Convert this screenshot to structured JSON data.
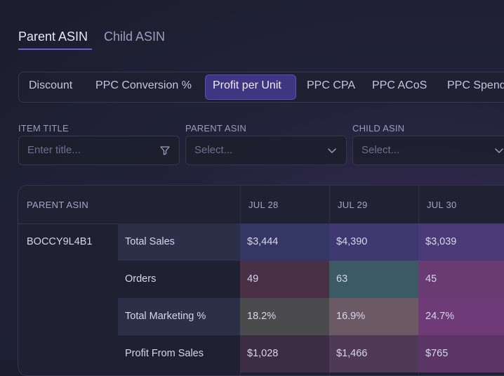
{
  "top_tabs": {
    "parent": "Parent ASIN",
    "child": "Child ASIN"
  },
  "metrics": [
    "Discount",
    "PPC Conversion %",
    "Profit per Unit",
    "PPC CPA",
    "PPC ACoS",
    "PPC Spend"
  ],
  "active_metric": "Profit per Unit",
  "filters": {
    "item_title_label": "ITEM TITLE",
    "item_title_placeholder": "Enter title...",
    "parent_asin_label": "PARENT ASIN",
    "parent_asin_placeholder": "Select...",
    "child_asin_label": "CHILD ASIN",
    "child_asin_placeholder": "Select..."
  },
  "table": {
    "header": {
      "parent_asin": "PARENT ASIN",
      "dates": [
        "JUL 28",
        "JUL 29",
        "JUL 30"
      ]
    },
    "asin": "BOCCY9L4B1",
    "rows": [
      {
        "label": "Total Sales",
        "values": [
          "$3,444",
          "$4,390",
          "$3,039"
        ],
        "colors": [
          "#343764",
          "#3d3870",
          "#4a3b78"
        ]
      },
      {
        "label": "Orders",
        "values": [
          "49",
          "63",
          "45"
        ],
        "colors": [
          "#4a3046",
          "#3c5a63",
          "#6a3b73"
        ]
      },
      {
        "label": "Total Marketing %",
        "values": [
          "18.2%",
          "16.9%",
          "24.7%"
        ],
        "colors": [
          "#4b4a4c",
          "#6b5a63",
          "#6e3a78"
        ]
      },
      {
        "label": "Profit From Sales",
        "values": [
          "$1,028",
          "$1,466",
          "$765"
        ],
        "colors": [
          "#3d2d44",
          "#4f3a55",
          "#5a3566"
        ]
      }
    ]
  }
}
